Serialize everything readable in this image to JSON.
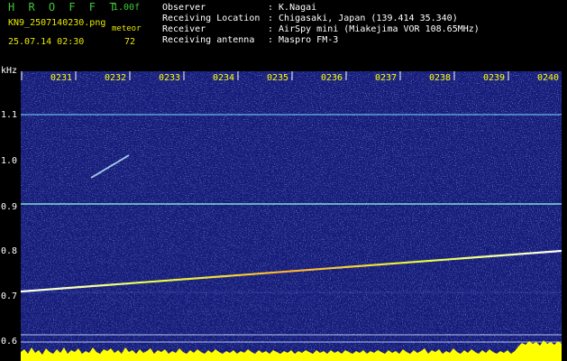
{
  "header": {
    "app_title": "H R O F F T",
    "version": "1.00f",
    "filename": "KN9_2507140230.png",
    "meteor_label": "meteor",
    "datetime": "25.07.14 02:30",
    "meteor_count": "72"
  },
  "info": [
    {
      "label": "Observer",
      "value": ": K.Nagai"
    },
    {
      "label": "Receiving Location",
      "value": ": Chigasaki, Japan (139.414 35.340)"
    },
    {
      "label": "Receiver",
      "value": ": AirSpy mini (Miakejima VOR 108.65MHz)"
    },
    {
      "label": "Receiving antenna",
      "value": ": Maspro FM-3"
    }
  ],
  "axis": {
    "y_unit": "kHz",
    "time_ticks": [
      "0231",
      "0232",
      "0233",
      "0234",
      "0235",
      "0236",
      "0237",
      "0238",
      "0239",
      "0240"
    ],
    "freq_ticks": [
      "1.1",
      "1.0",
      "0.9",
      "0.8",
      "0.7",
      "0.6"
    ]
  },
  "colors": {
    "background": "#000000",
    "spectrogram_base": "#141a78",
    "tick_label": "#ffff00",
    "title": "#3fc838",
    "trace": "#e8ff40"
  }
}
